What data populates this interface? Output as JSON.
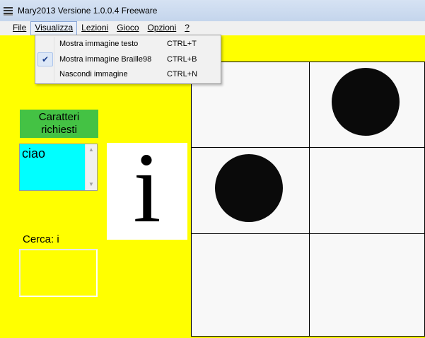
{
  "window": {
    "title": "Mary2013 Versione 1.0.0.4 Freeware"
  },
  "menubar": {
    "file": "File",
    "visualizza": "Visualizza",
    "lezioni": "Lezioni",
    "gioco": "Gioco",
    "opzioni": "Opzioni",
    "help": "?"
  },
  "dropdown": {
    "items": [
      {
        "label": "Mostra immagine testo",
        "shortcut": "CTRL+T",
        "checked": false
      },
      {
        "label": "Mostra immagine Braille98",
        "shortcut": "CTRL+B",
        "checked": true
      },
      {
        "label": "Nascondi immagine",
        "shortcut": "CTRL+N",
        "checked": false
      }
    ]
  },
  "panel": {
    "header": "Caratteri richiesti",
    "chars_value": "ciao",
    "letter": "i",
    "cerca_label": "Cerca:  i"
  },
  "braille": {
    "rows": 3,
    "cols": 2,
    "dots_filled": [
      false,
      true,
      true,
      false,
      false,
      false
    ]
  },
  "colors": {
    "background": "#ffff00",
    "header_green": "#44c244",
    "chars_cyan": "#00ffff"
  },
  "icons": {
    "app": "abacus-icon",
    "scroll_up": "scroll-up-arrow-icon",
    "scroll_down": "scroll-down-arrow-icon",
    "check": "checkmark-icon"
  }
}
